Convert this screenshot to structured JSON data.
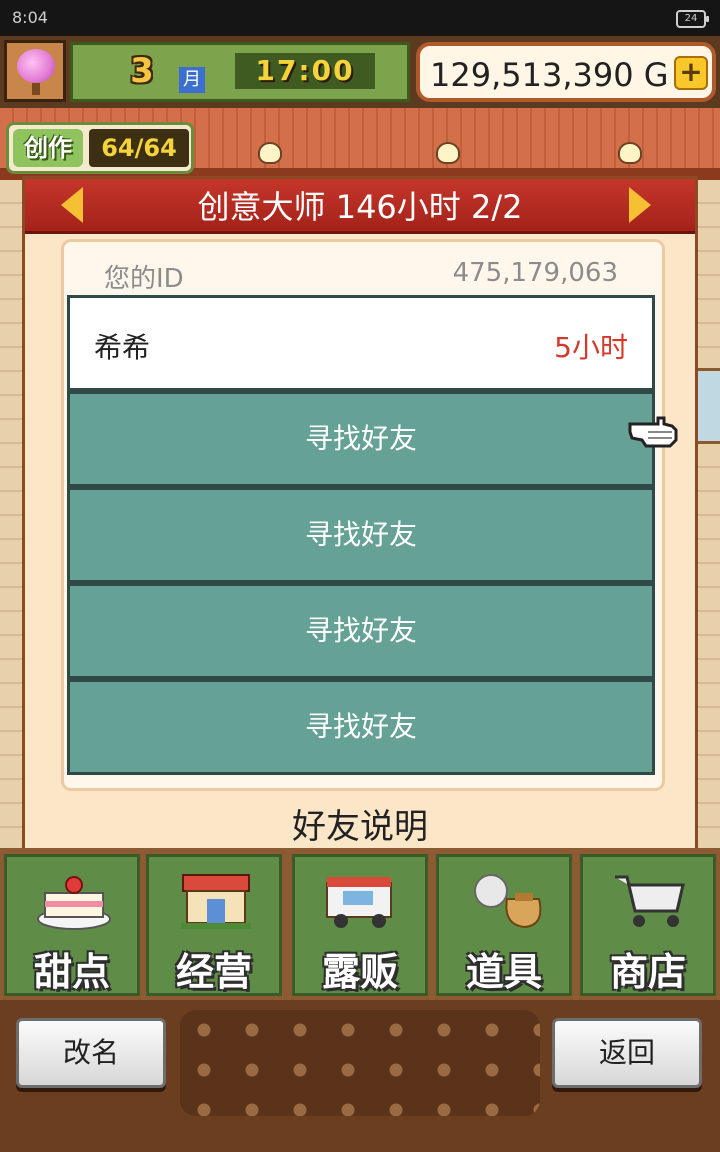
{
  "status_bar": {
    "time": "8:04",
    "battery": "24"
  },
  "hud": {
    "month_number": "3",
    "month_label": "月",
    "clock": "17:00",
    "gold": "129,513,390",
    "gold_unit": "G",
    "gold_add": "+"
  },
  "create_badge": {
    "label": "创作",
    "count": "64/64"
  },
  "dialog": {
    "title": "创意大师  146小时 2/2",
    "id_label": "您的ID",
    "id_value": "475,179,063",
    "friends": [
      {
        "name": "希希",
        "time": "5小时"
      }
    ],
    "find_friend_label": "寻找好友",
    "find_slots": [
      "寻找好友",
      "寻找好友",
      "寻找好友",
      "寻找好友"
    ],
    "explain": "好友说明"
  },
  "menu": [
    {
      "label": "甜点",
      "icon": "cake-icon"
    },
    {
      "label": "经营",
      "icon": "shop-icon"
    },
    {
      "label": "露贩",
      "icon": "food-truck-icon"
    },
    {
      "label": "道具",
      "icon": "item-bag-icon"
    },
    {
      "label": "商店",
      "icon": "cart-icon"
    }
  ],
  "bottom": {
    "rename": "改名",
    "back": "返回"
  },
  "colors": {
    "header_red": "#b02a1f",
    "find_row_teal": "#66a196",
    "time_red": "#d4392b",
    "menu_green": "#5f8c47"
  }
}
